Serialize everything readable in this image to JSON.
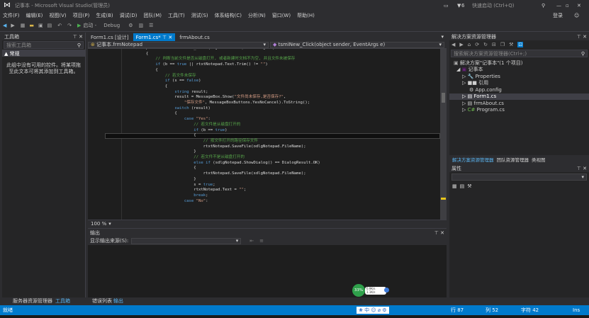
{
  "window": {
    "title": "记事本 - Microsoft Visual Studio(管理员)",
    "quick_launch": "快速启动 (Ctrl+Q)",
    "notif_count": "6",
    "login": "登录"
  },
  "menu": [
    "文件(F)",
    "编辑(E)",
    "视图(V)",
    "项目(P)",
    "生成(B)",
    "调试(D)",
    "团队(M)",
    "工具(T)",
    "测试(S)",
    "体系结构(C)",
    "分析(N)",
    "窗口(W)",
    "帮助(H)"
  ],
  "toolbar": {
    "start": "启动 -",
    "config": "Debug"
  },
  "toolbox": {
    "title": "工具箱",
    "search_placeholder": "搜索工具箱",
    "group": "▲ 常规",
    "empty_text": "此组中没有可用的控件。将某项拖至此文本可将其添加到工具箱。"
  },
  "side_strip": "服务器资源管理器",
  "tabs": [
    {
      "label": "Form1.cs [设计]",
      "active": false
    },
    {
      "label": "Form1.cs*",
      "active": true
    },
    {
      "label": "frmAbout.cs",
      "active": false
    }
  ],
  "nav": {
    "class_combo": "记事本.frmNotepad",
    "member_combo": "tsmiNew_Click(object sender, EventArgs e)"
  },
  "code_lines": [
    [
      [
        "tx",
        "        private void tsmiNew_Click(object sender, EventArgs e)"
      ]
    ],
    [
      [
        "tx",
        "        {"
      ]
    ],
    [
      [
        "cm",
        "            // 判断当前文件是否从磁盘打开, 或者新建时文档不为空, 并且文件未被保存"
      ]
    ],
    [
      [
        "kw",
        "            if "
      ],
      [
        "tx",
        "(b == "
      ],
      [
        "kw",
        "true"
      ],
      [
        "tx",
        " || rtxtNotepad.Text.Trim() != "
      ],
      [
        "str",
        "\"\""
      ],
      [
        "tx",
        ")"
      ]
    ],
    [
      [
        "tx",
        "            {"
      ]
    ],
    [
      [
        "cm",
        "                // 若文件未保存"
      ]
    ],
    [
      [
        "kw",
        "                if "
      ],
      [
        "tx",
        "(s == "
      ],
      [
        "kw",
        "false"
      ],
      [
        "tx",
        ")"
      ]
    ],
    [
      [
        "tx",
        "                {"
      ]
    ],
    [
      [
        "kw",
        "                    string "
      ],
      [
        "tx",
        "result;"
      ]
    ],
    [
      [
        "tx",
        "                    result = MessageBox.Show("
      ],
      [
        "str",
        "\"文件尚未保存,是否保存?\""
      ],
      [
        "tx",
        ","
      ]
    ],
    [
      [
        "str",
        "                        \"保存文件\""
      ],
      [
        "tx",
        ", MessageBoxButtons.YesNoCancel).ToString();"
      ]
    ],
    [
      [
        "kw",
        "                    switch "
      ],
      [
        "tx",
        "(result)"
      ]
    ],
    [
      [
        "tx",
        "                    {"
      ]
    ],
    [
      [
        "kw",
        "                        case "
      ],
      [
        "str",
        "\"Yes\""
      ],
      [
        "tx",
        ":"
      ]
    ],
    [
      [
        "cm",
        "                            // 若文件是从磁盘打开的"
      ]
    ],
    [
      [
        "kw",
        "                            if "
      ],
      [
        "tx",
        "(b == "
      ],
      [
        "kw",
        "true"
      ],
      [
        "tx",
        ")"
      ]
    ],
    [
      [
        "tx",
        "                            {"
      ]
    ],
    [
      [
        "cm",
        "                                // 按文件打开的路径保存文件"
      ]
    ],
    [
      [
        "tx",
        "                                rtxtNotepad.SaveFile(odlgNotepad.FileName);"
      ]
    ],
    [
      [
        "tx",
        "                            }"
      ]
    ],
    [
      [
        "cm",
        "                            // 若文件不是从磁盘打开的"
      ]
    ],
    [
      [
        "kw",
        "                            else if "
      ],
      [
        "tx",
        "(sdlgNotepad.ShowDialog() == DialogResult.OK)"
      ]
    ],
    [
      [
        "tx",
        "                            {"
      ]
    ],
    [
      [
        "tx",
        "                                rtxtNotepad.SaveFile(sdlgNotepad.FileName);"
      ]
    ],
    [
      [
        "tx",
        "                            }"
      ]
    ],
    [
      [
        "tx",
        "                            s = "
      ],
      [
        "kw",
        "true"
      ],
      [
        "tx",
        ";"
      ]
    ],
    [
      [
        "tx",
        "                            rtxtNotepad.Text = "
      ],
      [
        "str",
        "\"\""
      ],
      [
        "tx",
        ";"
      ]
    ],
    [
      [
        "kw",
        "                            break"
      ],
      [
        "tx",
        ";"
      ]
    ],
    [
      [
        "kw",
        "                        case "
      ],
      [
        "str",
        "\"No\""
      ],
      [
        "tx",
        ":"
      ]
    ]
  ],
  "zoom": "100 %",
  "output": {
    "title": "输出",
    "source_label": "显示输出来源(S):"
  },
  "solution": {
    "title": "解决方案资源管理器",
    "search_placeholder": "搜索解决方案资源管理器(Ctrl+;)",
    "items": [
      "解决方案\"记事本\"(1 个项目)",
      "记事本",
      "Properties",
      "引用",
      "App.config",
      "Form1.cs",
      "frmAbout.cs",
      "Program.cs"
    ],
    "selected_index": 5
  },
  "sol_tabs": [
    "解决方案资源管理器",
    "团队资源管理器",
    "类视图"
  ],
  "props": {
    "title": "属性"
  },
  "bottom_tabs": {
    "left1": "服务器资源管理器",
    "left2": "工具箱",
    "mid1": "错误列表",
    "mid2": "输出"
  },
  "status": {
    "ready": "就绪",
    "line": "行 87",
    "col": "列 52",
    "ch": "字符 42",
    "ins": "Ins"
  },
  "widget": {
    "percent": "33%",
    "up": "0.9K/s",
    "down": "1.1K/s"
  },
  "colors": {
    "accent": "#007acc",
    "keyword": "#569cd6",
    "string": "#d69d85",
    "comment": "#57a64a"
  }
}
